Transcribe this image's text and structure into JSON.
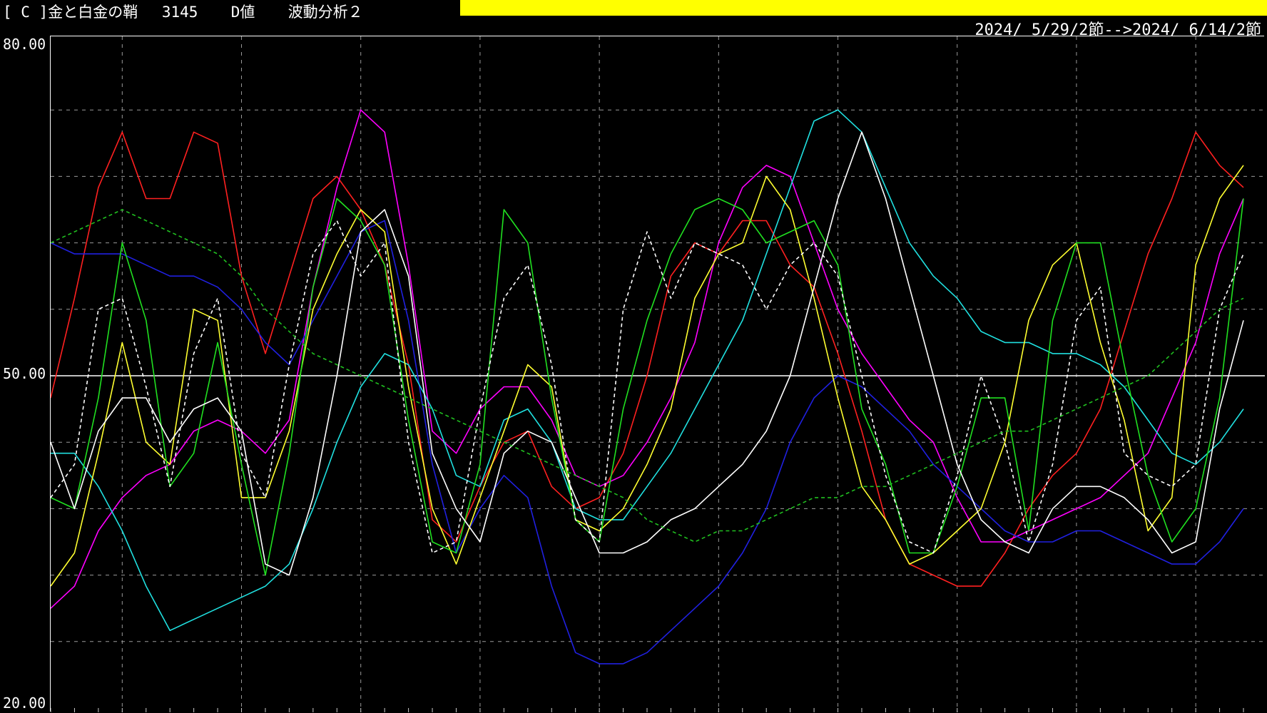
{
  "header": {
    "title": "[ C ]金と白金の鞘　 3145 　 D値 　 波動分析２",
    "date_range": "2024/ 5/29/2節-->2024/ 6/14/2節",
    "accent_bar_color": "#ffff00"
  },
  "chart_data": {
    "type": "line",
    "title": "",
    "xlabel": "",
    "ylabel": "",
    "ylim": [
      20,
      80
    ],
    "y_tick_labels": [
      "80.00",
      "50.00",
      "20.00"
    ],
    "reference_line": 50,
    "grid": true,
    "grid_style": "dashed",
    "x": [
      0,
      1,
      2,
      3,
      4,
      5,
      6,
      7,
      8,
      9,
      10,
      11,
      12,
      13,
      14,
      15,
      16,
      17,
      18,
      19,
      20,
      21,
      22,
      23,
      24,
      25,
      26,
      27,
      28,
      29,
      30,
      31,
      32,
      33,
      34,
      35,
      36,
      37,
      38,
      39,
      40,
      41,
      42,
      43,
      44,
      45,
      46,
      47,
      48,
      49,
      50
    ],
    "series": [
      {
        "color": "#ff2020",
        "dashed": false,
        "values": [
          48,
          57,
          67,
          72,
          66,
          66,
          72,
          71,
          59,
          52,
          59,
          66,
          68,
          65,
          60,
          51,
          37,
          35,
          40,
          44,
          45,
          40,
          38,
          39,
          43,
          50,
          59,
          62,
          61,
          64,
          64,
          60,
          58,
          52,
          45,
          37,
          33,
          32,
          31,
          31,
          34,
          38,
          41,
          43,
          47,
          54,
          61,
          66,
          72,
          69,
          67
        ]
      },
      {
        "color": "#ff00ff",
        "dashed": false,
        "values": [
          29,
          31,
          36,
          39,
          41,
          42,
          45,
          46,
          45,
          43,
          46,
          58,
          67,
          74,
          72,
          60,
          45,
          43,
          47,
          49,
          49,
          46,
          41,
          40,
          41,
          44,
          48,
          53,
          62,
          67,
          69,
          68,
          62,
          56,
          52,
          49,
          46,
          44,
          39,
          35,
          35,
          36,
          37,
          38,
          39,
          41,
          43,
          48,
          53,
          61,
          66
        ]
      },
      {
        "color": "#2020e0",
        "dashed": false,
        "values": [
          62,
          61,
          61,
          61,
          60,
          59,
          59,
          58,
          56,
          53,
          51,
          55,
          59,
          63,
          64,
          55,
          42,
          34,
          38,
          41,
          39,
          31,
          25,
          24,
          24,
          25,
          27,
          29,
          31,
          34,
          38,
          44,
          48,
          50,
          49,
          47,
          45,
          42,
          40,
          38,
          36,
          35,
          35,
          36,
          36,
          35,
          34,
          33,
          33,
          35,
          38
        ]
      },
      {
        "color": "#20e0e0",
        "dashed": false,
        "values": [
          43,
          43,
          40,
          36,
          31,
          27,
          28,
          29,
          30,
          31,
          33,
          38,
          44,
          49,
          52,
          51,
          47,
          41,
          40,
          46,
          47,
          44,
          38,
          37,
          37,
          40,
          43,
          47,
          51,
          55,
          61,
          67,
          73,
          74,
          72,
          67,
          62,
          59,
          57,
          54,
          53,
          53,
          52,
          52,
          51,
          49,
          46,
          43,
          42,
          44,
          47
        ]
      },
      {
        "color": "#ffff30",
        "dashed": false,
        "values": [
          31,
          34,
          43,
          53,
          44,
          42,
          56,
          55,
          39,
          39,
          45,
          56,
          61,
          65,
          63,
          49,
          38,
          33,
          39,
          45,
          51,
          49,
          37,
          36,
          38,
          42,
          47,
          57,
          61,
          62,
          68,
          65,
          57,
          48,
          40,
          37,
          33,
          34,
          36,
          38,
          44,
          55,
          60,
          62,
          53,
          46,
          36,
          39,
          60,
          66,
          69
        ]
      },
      {
        "color": "#20e020",
        "dashed": false,
        "values": [
          39,
          38,
          48,
          62,
          55,
          40,
          43,
          53,
          42,
          32,
          43,
          58,
          66,
          64,
          60,
          46,
          35,
          34,
          42,
          65,
          62,
          48,
          37,
          35,
          47,
          55,
          61,
          65,
          66,
          65,
          62,
          63,
          64,
          60,
          47,
          42,
          34,
          34,
          40,
          48,
          48,
          36,
          55,
          62,
          62,
          51,
          41,
          35,
          38,
          48,
          66
        ]
      },
      {
        "color": "#ffffff",
        "dashed": false,
        "values": [
          44,
          38,
          45,
          48,
          48,
          44,
          47,
          48,
          45,
          33,
          32,
          39,
          50,
          63,
          65,
          59,
          43,
          38,
          35,
          43,
          45,
          44,
          39,
          34,
          34,
          35,
          37,
          38,
          40,
          42,
          45,
          50,
          58,
          66,
          72,
          66,
          58,
          50,
          42,
          37,
          35,
          34,
          38,
          40,
          40,
          39,
          37,
          34,
          35,
          47,
          55
        ]
      },
      {
        "color": "#ffffff",
        "dashed": true,
        "values": [
          39,
          42,
          56,
          57,
          49,
          40,
          52,
          57,
          43,
          39,
          51,
          61,
          64,
          59,
          62,
          44,
          34,
          35,
          47,
          57,
          60,
          51,
          37,
          35,
          56,
          63,
          57,
          62,
          61,
          60,
          56,
          60,
          62,
          59,
          50,
          41,
          35,
          34,
          41,
          50,
          44,
          35,
          42,
          55,
          58,
          43,
          41,
          40,
          42,
          56,
          61
        ]
      },
      {
        "color": "#20c020",
        "dashed": true,
        "values": [
          62,
          63,
          64,
          65,
          64,
          63,
          62,
          61,
          59,
          56,
          54,
          52,
          51,
          50,
          49,
          48,
          47,
          46,
          45,
          44,
          43,
          42,
          41,
          40,
          39,
          37,
          36,
          35,
          36,
          36,
          37,
          38,
          39,
          39,
          40,
          40,
          41,
          42,
          43,
          44,
          45,
          45,
          46,
          47,
          48,
          49,
          50,
          52,
          54,
          56,
          57
        ]
      }
    ]
  }
}
